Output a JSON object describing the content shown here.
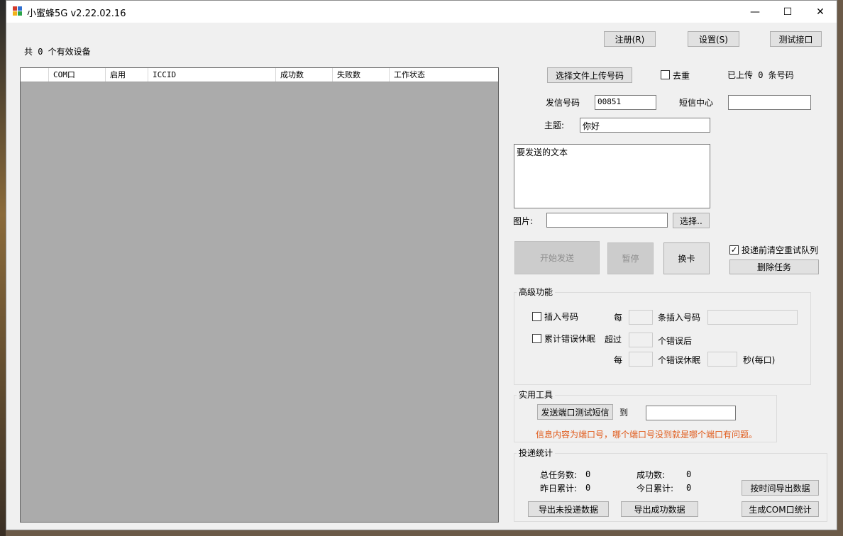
{
  "window": {
    "title": "小蜜蜂5G v2.22.02.16",
    "minimize": "—",
    "maximize": "☐",
    "close": "✕"
  },
  "top_buttons": {
    "register": "注册(R)",
    "settings": "设置(S)",
    "test_api": "测试接口"
  },
  "device_count": "共 0 个有效设备",
  "grid": {
    "columns": [
      "",
      "COM口",
      "启用",
      "ICCID",
      "成功数",
      "失败数",
      "工作状态"
    ]
  },
  "upload": {
    "button": "选择文件上传号码",
    "dedupe_label": "去重",
    "dedupe_checked": false,
    "uploaded_status": "已上传 0 条号码"
  },
  "sender": {
    "label": "发信号码",
    "value": "00851",
    "sms_center_label": "短信中心",
    "sms_center_value": ""
  },
  "subject": {
    "label": "主题:",
    "value": "你好"
  },
  "message_text": "要发送的文本",
  "image": {
    "label": "图片:",
    "value": "",
    "choose_button": "选择.."
  },
  "actions": {
    "start": "开始发送",
    "pause": "暂停",
    "switch_card": "换卡",
    "clear_queue_label": "投递前清空重试队列",
    "clear_queue_checked": true,
    "delete_task": "删除任务"
  },
  "advanced": {
    "title": "高级功能",
    "insert_number_label": "插入号码",
    "insert_number_checked": false,
    "every_label": "每",
    "insert_after_label": "条插入号码",
    "sleep_label": "累计错误休眠",
    "sleep_checked": false,
    "exceed_label": "超过",
    "after_errors_label": "个错误后",
    "every2_label": "每",
    "errors_sleep_label": "个错误休眠",
    "seconds_label": "秒(每口)"
  },
  "tools": {
    "title": "实用工具",
    "send_test_button": "发送端口测试短信",
    "to_label": "到",
    "to_value": "",
    "hint": "信息内容为端口号，哪个端口号没到就是哪个端口有问题。"
  },
  "stats": {
    "title": "投递统计",
    "total_label": "总任务数:",
    "total_value": "0",
    "success_label": "成功数:",
    "success_value": "0",
    "yesterday_label": "昨日累计:",
    "yesterday_value": "0",
    "today_label": "今日累计:",
    "today_value": "0",
    "export_by_time": "按时间导出数据",
    "export_undelivered": "导出未投递数据",
    "export_success": "导出成功数据",
    "generate_com_stats": "生成COM口统计"
  }
}
